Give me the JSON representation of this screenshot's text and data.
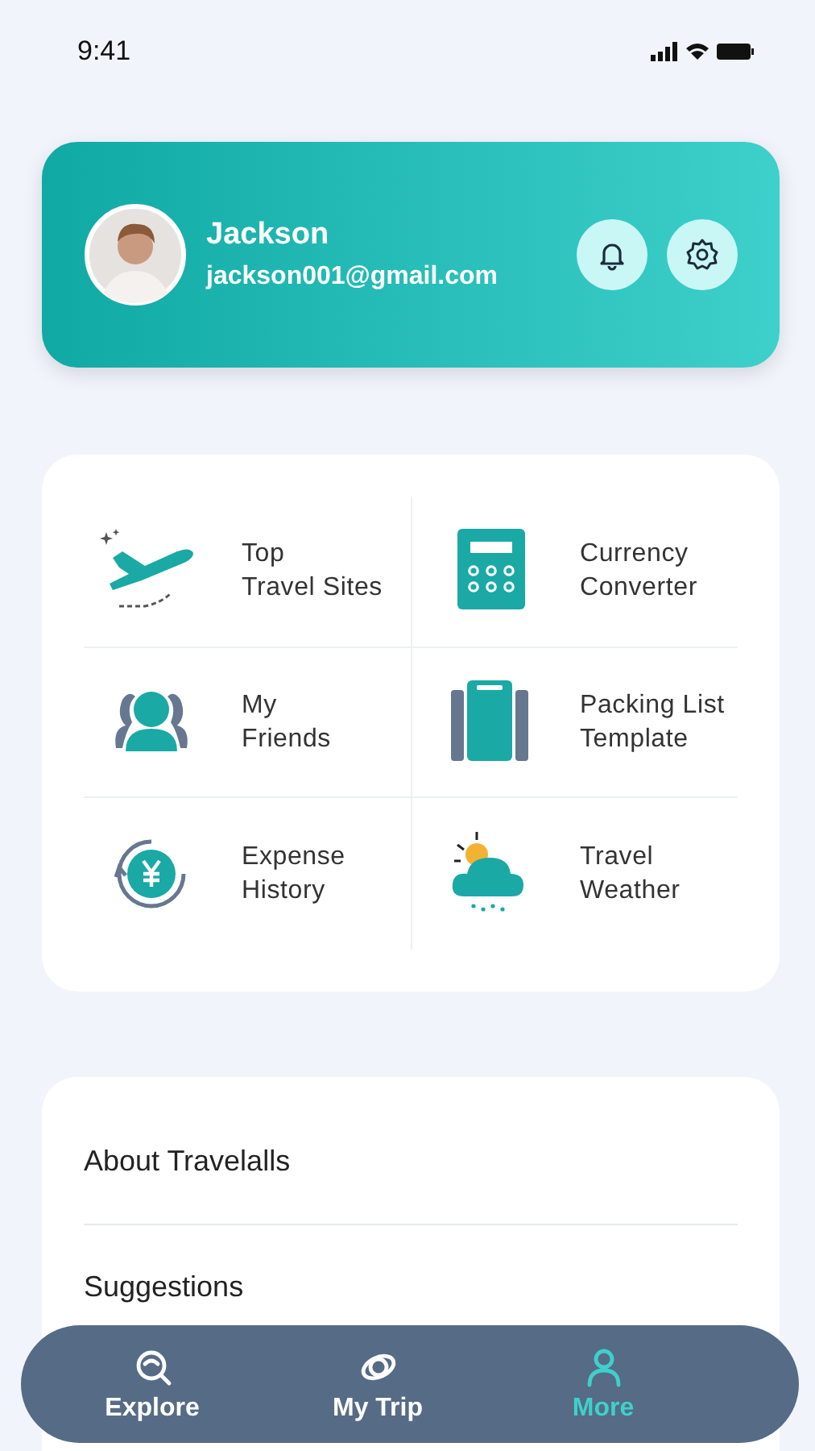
{
  "status_bar": {
    "time": "9:41"
  },
  "profile": {
    "name": "Jackson",
    "email": "jackson001@gmail.com"
  },
  "features": [
    {
      "kind": "plane",
      "line1": "Top",
      "line2": "Travel Sites"
    },
    {
      "kind": "calculator",
      "line1": "Currency",
      "line2": "Converter"
    },
    {
      "kind": "friends",
      "line1": "My",
      "line2": "Friends"
    },
    {
      "kind": "luggage",
      "line1": "Packing List",
      "line2": "Template"
    },
    {
      "kind": "expense",
      "line1": "Expense",
      "line2": "History"
    },
    {
      "kind": "weather",
      "line1": "Travel",
      "line2": "Weather"
    }
  ],
  "menu": [
    "About Travelalls",
    "Suggestions"
  ],
  "nav": [
    {
      "kind": "explore",
      "label": "Explore",
      "selected": false
    },
    {
      "kind": "trip",
      "label": "My Trip",
      "selected": false
    },
    {
      "kind": "more",
      "label": "More",
      "selected": true
    }
  ]
}
